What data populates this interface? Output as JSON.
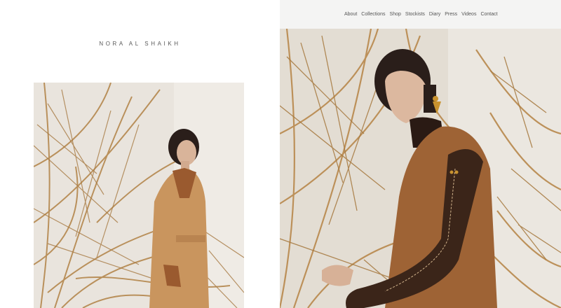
{
  "brand": {
    "name": "NORA AL SHAIKH"
  },
  "nav": {
    "items": [
      {
        "label": "About"
      },
      {
        "label": "Collections"
      },
      {
        "label": "Shop"
      },
      {
        "label": "Stockists"
      },
      {
        "label": "Diary"
      },
      {
        "label": "Press"
      },
      {
        "label": "Videos"
      },
      {
        "label": "Contact"
      }
    ]
  },
  "colors": {
    "page_background": "#ffffff",
    "nav_background": "#f4f4f3",
    "nav_text": "#555555",
    "brand_text": "#5a5a5a",
    "photo_backdrop": "#e8e3dc",
    "palm": "#b98a4f",
    "coat_camel": "#c9955e",
    "coat_rust": "#9a5a2f",
    "leather_sleeve": "#3a2418"
  },
  "images": {
    "left_photo": {
      "icon": "fashion-photo-icon"
    },
    "right_photo": {
      "icon": "fashion-photo-icon"
    }
  }
}
